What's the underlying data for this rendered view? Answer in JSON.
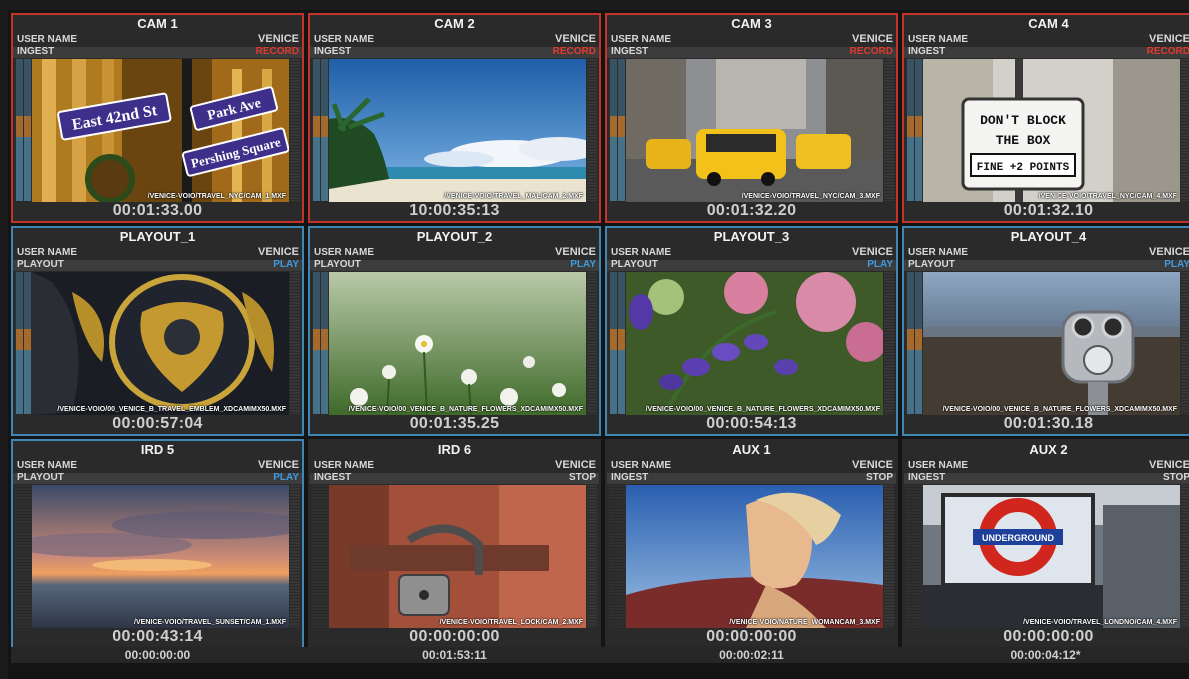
{
  "tiles": [
    {
      "title": "CAM 1",
      "user": "USER NAME",
      "mode": "INGEST",
      "server": "VENICE",
      "state": "RECORD",
      "state_kind": "record",
      "path": "/VENICE-VOIO/TRAVEL_NYC/CAM_1.MXF",
      "timecode": "00:01:33.00",
      "scene": "nyc-street-signs"
    },
    {
      "title": "CAM 2",
      "user": "USER NAME",
      "mode": "INGEST",
      "server": "VENICE",
      "state": "RECORD",
      "state_kind": "record",
      "path": "/VENICE-VOIO/TRAVEL_MAL/CAM_2.MXF",
      "timecode": "10:00:35:13",
      "scene": "beach"
    },
    {
      "title": "CAM 3",
      "user": "USER NAME",
      "mode": "INGEST",
      "server": "VENICE",
      "state": "RECORD",
      "state_kind": "record",
      "path": "/VENICE-VOIO/TRAVEL_NYC/CAM_3.MXF",
      "timecode": "00:01:32.20",
      "scene": "taxis"
    },
    {
      "title": "CAM 4",
      "user": "USER NAME",
      "mode": "INGEST",
      "server": "VENICE",
      "state": "RECORD",
      "state_kind": "record",
      "path": "/VENICE-VOIO/TRAVEL_NYC/CAM_4.MXF",
      "timecode": "00:01:32.10",
      "scene": "dont-block-sign"
    },
    {
      "title": "PLAYOUT_1",
      "user": "USER NAME",
      "mode": "PLAYOUT",
      "server": "VENICE",
      "state": "PLAY",
      "state_kind": "play",
      "path": "/VENICE-VOIO/00_VENICE_B_TRAVEL_EMBLEM_XDCAMIMX50.MXF",
      "timecode": "00:00:57:04",
      "scene": "emblem"
    },
    {
      "title": "PLAYOUT_2",
      "user": "USER NAME",
      "mode": "PLAYOUT",
      "server": "VENICE",
      "state": "PLAY",
      "state_kind": "play",
      "path": "/VENICE-VOIO/00_VENICE_B_NATURE_FLOWERS_XDCAMIMX50.MXF",
      "timecode": "00:01:35.25",
      "scene": "daisies"
    },
    {
      "title": "PLAYOUT_3",
      "user": "USER NAME",
      "mode": "PLAYOUT",
      "server": "VENICE",
      "state": "PLAY",
      "state_kind": "play",
      "path": "/VENICE-VOIO/00_VENICE_B_NATURE_FLOWERS_XDCAMIMX50.MXF",
      "timecode": "00:00:54:13",
      "scene": "bluebells"
    },
    {
      "title": "PLAYOUT_4",
      "user": "USER NAME",
      "mode": "PLAYOUT",
      "server": "VENICE",
      "state": "PLAY",
      "state_kind": "play",
      "path": "/VENICE-VOIO/00_VENICE_B_NATURE_FLOWERS_XDCAMIMX50.MXF",
      "timecode": "00:01:30.18",
      "scene": "binoculars"
    },
    {
      "title": "IRD 5",
      "user": "USER NAME",
      "mode": "PLAYOUT",
      "server": "VENICE",
      "state": "PLAY",
      "state_kind": "play",
      "path": "/VENICE-VOIO/TRAVEL_SUNSET/CAM_1.MXF",
      "timecode": "00:00:43:14",
      "timecode2": "00:00:00:00",
      "scene": "sunset"
    },
    {
      "title": "IRD 6",
      "user": "USER NAME",
      "mode": "INGEST",
      "server": "VENICE",
      "state": "STOP",
      "state_kind": "stop",
      "path": "/VENICE-VOIO/TRAVEL_LOCK/CAM_2.MXF",
      "timecode": "00:00:00:00",
      "timecode2": "00:01:53:11",
      "scene": "lock"
    },
    {
      "title": "AUX 1",
      "user": "USER NAME",
      "mode": "INGEST",
      "server": "VENICE",
      "state": "STOP",
      "state_kind": "stop",
      "path": "/VENICE-VOIO/NATURE_WOMANCAM_3.MXF",
      "timecode": "00:00:00:00",
      "timecode2": "00:00:02:11",
      "scene": "woman"
    },
    {
      "title": "AUX 2",
      "user": "USER NAME",
      "mode": "INGEST",
      "server": "VENICE",
      "state": "STOP",
      "state_kind": "stop",
      "path": "/VENICE-VOIO/TRAVEL_LONDNO/CAM_4.MXF",
      "timecode": "00:00:00:00",
      "timecode2": "00:00:04:12*",
      "scene": "underground"
    }
  ],
  "scene_text": {
    "sign1": "East 42nd St",
    "sign2": "Park Ave",
    "sign3": "Pershing Square",
    "sign4_line1": "DON'T BLOCK",
    "sign4_line2": "THE BOX",
    "sign4_line3": "FINE +2 POINTS",
    "underground": "UNDERGROUND"
  },
  "colors": {
    "record": "#c2342a",
    "play": "#3f86b5",
    "panel": "#2a2a2a"
  }
}
